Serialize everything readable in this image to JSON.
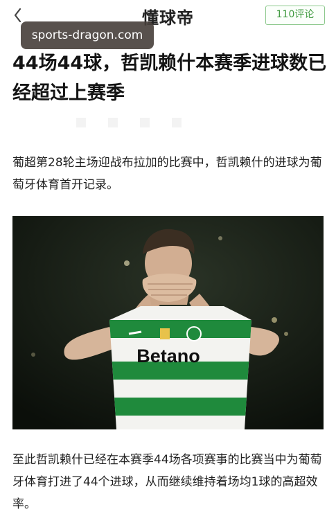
{
  "header": {
    "brand": "懂球帝",
    "comment_button": "110评论",
    "back_icon": "chevron-left-icon"
  },
  "watermark": "sports-dragon.com",
  "article": {
    "title": "44场44球，哲凯赖什本赛季进球数已经超过上赛季",
    "paragraphs": [
      "葡超第28轮主场迎战布拉加的比赛中，哲凯赖什的进球为葡萄牙体育首开记录。",
      "至此哲凯赖什已经在本赛季44场各项赛事的比赛当中为葡萄牙体育打进了44个进球，从而继续维持着场均1球的高超效率。"
    ],
    "photo": {
      "jersey_sponsor": "Betano"
    }
  },
  "colors": {
    "accent_green": "#3f9a3f",
    "jersey_green": "#1f8a3c"
  }
}
